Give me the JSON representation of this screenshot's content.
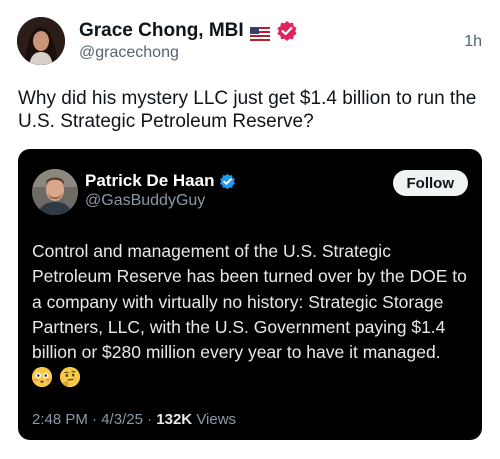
{
  "post": {
    "author": {
      "name": "Grace Chong, MBI",
      "flag_icon": "us-flag-icon",
      "badge_icon": "verified-badge-pink-icon",
      "badge_color": "#e0245e",
      "handle": "@gracechong"
    },
    "time": "1h",
    "text": "Why did his mystery LLC just get $1.4 billion to run the U.S. Strategic Petroleum Reserve?"
  },
  "quote": {
    "background": "#000000",
    "author": {
      "name": "Patrick De Haan",
      "badge_icon": "verified-badge-blue-icon",
      "badge_color": "#1d9bf0",
      "handle": "@GasBuddyGuy"
    },
    "follow_label": "Follow",
    "text": "Control and management of the U.S. Strategic Petroleum Reserve has been turned over by the DOE to a company with virtually no history: Strategic Storage Partners, LLC, with the U.S. Government paying $1.4 billion or $280 million every year to have it managed.",
    "emojis": [
      "flushed-face-icon",
      "thinking-face-icon"
    ],
    "meta": {
      "time": "2:48 PM",
      "date": "4/3/25",
      "separator": "·",
      "views_count": "132K",
      "views_label": "Views"
    }
  }
}
